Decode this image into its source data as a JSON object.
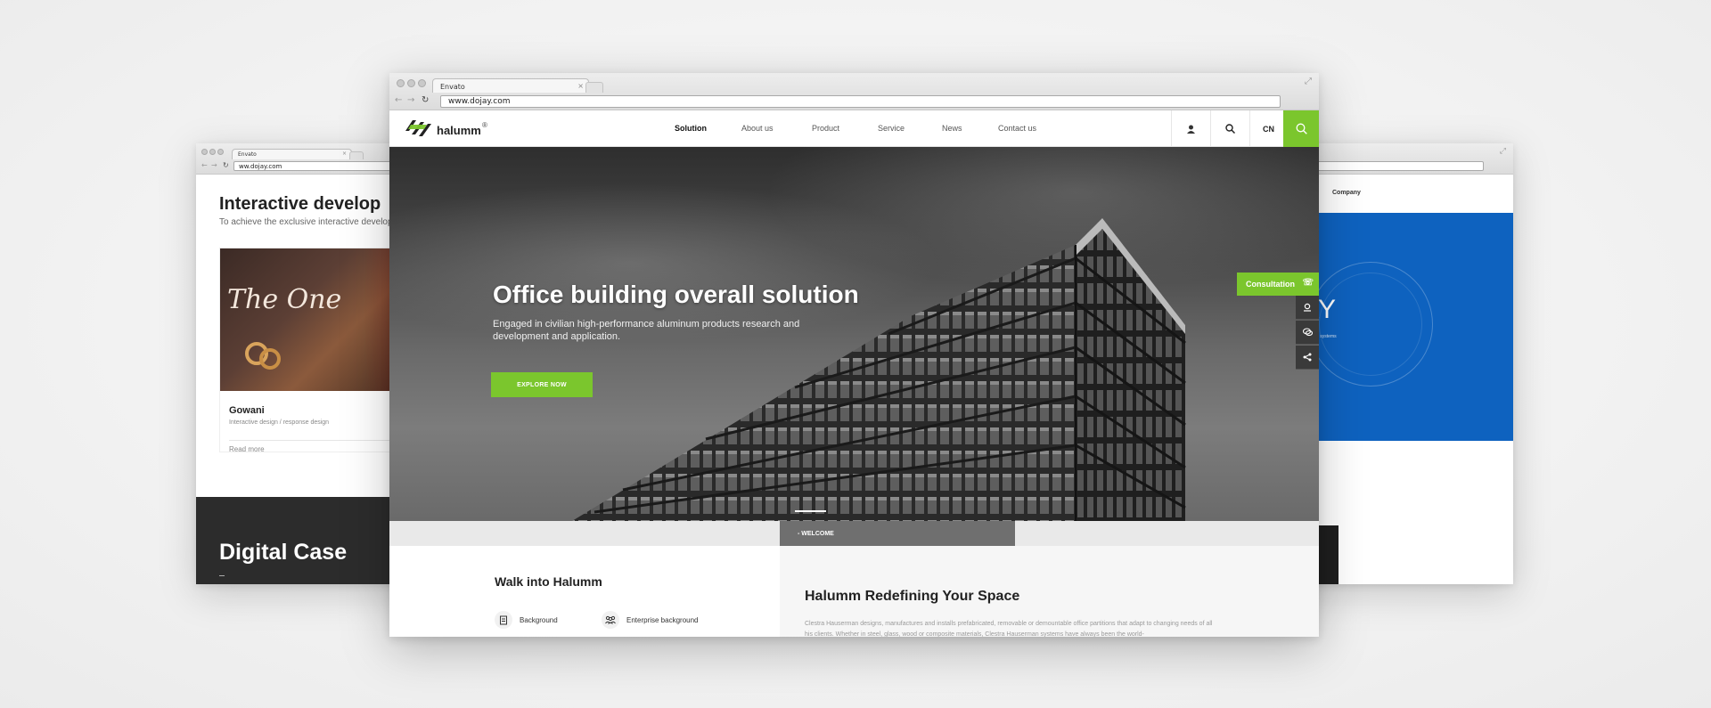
{
  "left_window": {
    "tab_title": "Envato",
    "url": "ww.dojay.com",
    "title": "Interactive develop",
    "subtitle": "To achieve the exclusive interactive developm",
    "card": {
      "image_text": "The One",
      "name": "Gowani",
      "tags": "Interactive design / response design",
      "link": "Read more"
    },
    "dark_section_title": "Digital Case"
  },
  "right_window": {
    "nav_item": "Company",
    "banner_text": "WAY",
    "banner_sub": "s, systems"
  },
  "main_window": {
    "tab_title": "Envato",
    "url": "www.dojay.com",
    "logo_text": "halumm",
    "logo_sup": "®",
    "nav": [
      "Solution",
      "About us",
      "Product",
      "Service",
      "News",
      "Contact us"
    ],
    "lang": "CN",
    "hero": {
      "title": "Office building overall solution",
      "subtitle": "Engaged in civilian high-performance aluminum products research and development and application.",
      "button": "EXPLORE NOW"
    },
    "consultation": "Consultation",
    "welcome": "- WELCOME",
    "walk_title": "Walk into Halumm",
    "features": [
      "Background",
      "Enterprise background"
    ],
    "redefining": {
      "title": "Halumm Redefining Your Space",
      "text": "Clestra Hauserman designs, manufactures and installs prefabricated, removable or demountable office partitions that adapt to changing needs of all his clients. Whether in steel, glass, wood or composite materials, Clestra Hauserman systems have always been the world-"
    },
    "accent_color": "#7bc62d"
  }
}
